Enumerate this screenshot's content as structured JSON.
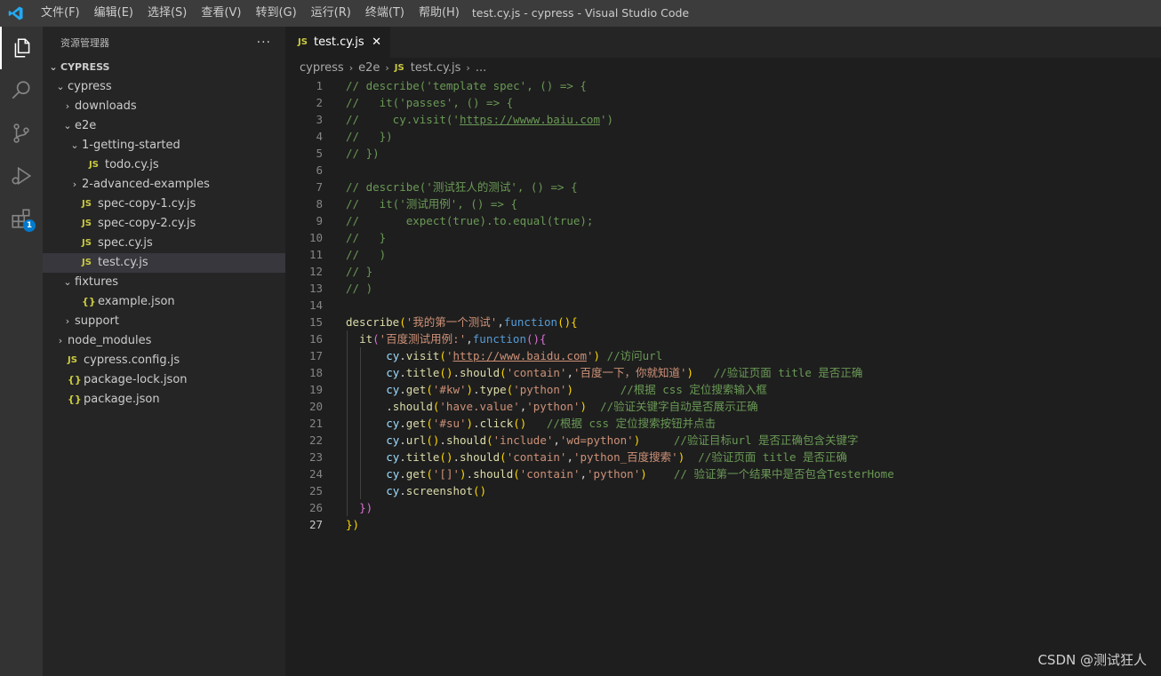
{
  "window": {
    "title": "test.cy.js - cypress - Visual Studio Code",
    "menu": [
      "文件(F)",
      "编辑(E)",
      "选择(S)",
      "查看(V)",
      "转到(G)",
      "运行(R)",
      "终端(T)",
      "帮助(H)"
    ]
  },
  "activity": {
    "extensions_badge": "1"
  },
  "sidebar": {
    "title": "资源管理器",
    "more": "···",
    "section": "CYPRESS",
    "items": [
      {
        "label": "cypress",
        "chev": "⌄",
        "icon": ""
      },
      {
        "label": "downloads",
        "chev": "›",
        "icon": ""
      },
      {
        "label": "e2e",
        "chev": "⌄",
        "icon": ""
      },
      {
        "label": "1-getting-started",
        "chev": "⌄",
        "icon": ""
      },
      {
        "label": "todo.cy.js",
        "chev": "",
        "icon": "JS"
      },
      {
        "label": "2-advanced-examples",
        "chev": "›",
        "icon": ""
      },
      {
        "label": "spec-copy-1.cy.js",
        "chev": "",
        "icon": "JS"
      },
      {
        "label": "spec-copy-2.cy.js",
        "chev": "",
        "icon": "JS"
      },
      {
        "label": "spec.cy.js",
        "chev": "",
        "icon": "JS"
      },
      {
        "label": "test.cy.js",
        "chev": "",
        "icon": "JS"
      },
      {
        "label": "fixtures",
        "chev": "⌄",
        "icon": ""
      },
      {
        "label": "example.json",
        "chev": "",
        "icon": "{}"
      },
      {
        "label": "support",
        "chev": "›",
        "icon": ""
      },
      {
        "label": "node_modules",
        "chev": "›",
        "icon": ""
      },
      {
        "label": "cypress.config.js",
        "chev": "",
        "icon": "JS"
      },
      {
        "label": "package-lock.json",
        "chev": "",
        "icon": "{}"
      },
      {
        "label": "package.json",
        "chev": "",
        "icon": "{}"
      }
    ]
  },
  "editor": {
    "tab": {
      "icon": "JS",
      "label": "test.cy.js",
      "close": "✕"
    },
    "breadcrumb": {
      "p1": "cypress",
      "p2": "e2e",
      "icon": "JS",
      "file": "test.cy.js",
      "tail": "..."
    },
    "lines": [
      "// describe('template spec', () => {",
      "//   it('passes', () => {",
      "//     cy.visit('https://wwww.baiu.com')",
      "//   })",
      "// })",
      "",
      "// describe('测试狂人的测试', () => {",
      "//   it('测试用例', () => {",
      "//       expect(true).to.equal(true);",
      "//   }",
      "//   )",
      "// }",
      "// )",
      "",
      "describe('我的第一个测试',function(){",
      "  it('百度测试用例:',function(){",
      "      cy.visit('http://www.baidu.com') //访问url",
      "      cy.title().should('contain','百度一下，你就知道')   //验证页面 title 是否正确",
      "      cy.get('#kw').type('python')       //根据 css 定位搜索输入框",
      "      .should('have.value','python')  //验证关键字自动是否展示正确",
      "      cy.get('#su').click()   //根据 css 定位搜索按钮并点击",
      "      cy.url().should('include','wd=python')     //验证目标url 是否正确包含关键字",
      "      cy.title().should('contain','python_百度搜索')  //验证页面 title 是否正确",
      "      cy.get('[]').should('contain','python')    // 验证第一个结果中是否包含TesterHome",
      "      cy.screenshot()",
      "  })",
      "})"
    ]
  },
  "watermark": "CSDN @测试狂人",
  "colors": {
    "accent": "#007acc",
    "comment": "#6a9955",
    "string": "#ce9178",
    "function": "#dcdcaa",
    "keyword": "#569cd6",
    "variable": "#9cdcfe"
  }
}
